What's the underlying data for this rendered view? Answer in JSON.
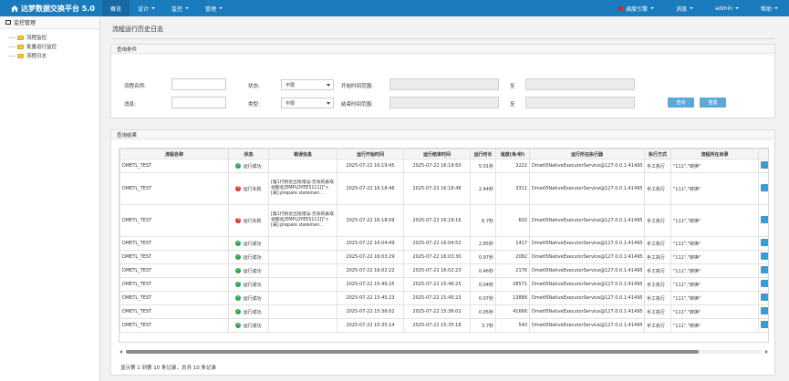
{
  "topbar": {
    "brand": "达梦数据交换平台 5.0",
    "nav": [
      {
        "label": "概览",
        "caret": false
      },
      {
        "label": "设计",
        "caret": true
      },
      {
        "label": "监控",
        "caret": true
      },
      {
        "label": "管理",
        "caret": true
      }
    ],
    "engine": "调度引擎",
    "messages": "消息",
    "user": "admin",
    "help": "帮助"
  },
  "sidebar": {
    "title": "监控管理",
    "items": [
      "流程监控",
      "批量运行监控",
      "流程日志"
    ]
  },
  "page": {
    "title": "流程运行历史日志"
  },
  "query": {
    "header": "查询条件",
    "name_label": "流程名称:",
    "status_label": "状态:",
    "status_value": "不限",
    "start_label": "开始时间范围:",
    "to1": "至",
    "msg_label": "消息:",
    "type_label": "类型:",
    "type_value": "不限",
    "end_label": "结束时间范围:",
    "to2": "至",
    "search_btn": "查询",
    "reset_btn": "重置"
  },
  "results": {
    "header": "查询结果",
    "columns": [
      "流程名称",
      "状态",
      "错误信息",
      "运行开始时间",
      "运行结束时间",
      "运行时长",
      "速度(条/秒)",
      "运行所在执行器",
      "执行方式",
      "流程所在目录",
      ""
    ],
    "rows": [
      {
        "name": "DMETL_TEST",
        "status": "运行成功",
        "ok": true,
        "error": "",
        "start": "2025-07-22 16:19:45",
        "end": "2025-07-22 16:19:50",
        "duration": "5.01秒",
        "speed": "3222",
        "executor": "DmetI5NativeExecutorService@127.0.0.1:41495",
        "mode": "手工执行",
        "dir": "\"111\",\"转换\""
      },
      {
        "name": "DMETL_TEST",
        "status": "运行失败",
        "ok": false,
        "error": "[第1行附近出现错误:无效的表或视图名[EMPLOYEES111]]\">[表]:prepare statemen...",
        "start": "2025-07-22 16:18:46",
        "end": "2025-07-22 16:18:48",
        "duration": "2.44秒",
        "speed": "3311",
        "executor": "DmetI5NativeExecutorService@127.0.0.1:41495",
        "mode": "手工执行",
        "dir": "\"111\",\"转换\""
      },
      {
        "name": "DMETL_TEST",
        "status": "运行失败",
        "ok": false,
        "error": "[第1行附近出现错误:无效的表或视图名[EMPLOYEES111]]\">[表]:prepare statemen...",
        "start": "2025-07-22 16:18:09",
        "end": "2025-07-22 16:18:16",
        "duration": "6.7秒",
        "speed": "602",
        "executor": "DmetI5NativeExecutorService@127.0.0.1:41495",
        "mode": "手工执行",
        "dir": "\"111\",\"转换\""
      },
      {
        "name": "DMETL_TEST",
        "status": "运行成功",
        "ok": true,
        "error": "",
        "start": "2025-07-22 16:04:49",
        "end": "2025-07-22 16:04:52",
        "duration": "2.85秒",
        "speed": "1417",
        "executor": "DmetI5NativeExecutorService@127.0.0.1:41495",
        "mode": "手工执行",
        "dir": "\"111\",\"转换\""
      },
      {
        "name": "DMETL_TEST",
        "status": "运行成功",
        "ok": true,
        "error": "",
        "start": "2025-07-22 16:03:29",
        "end": "2025-07-22 16:03:30",
        "duration": "0.97秒",
        "speed": "2082",
        "executor": "DmetI5NativeExecutorService@127.0.0.1:41495",
        "mode": "手工执行",
        "dir": "\"111\",\"转换\""
      },
      {
        "name": "DMETL_TEST",
        "status": "运行成功",
        "ok": true,
        "error": "",
        "start": "2025-07-22 16:02:22",
        "end": "2025-07-22 16:02:23",
        "duration": "0.46秒",
        "speed": "2176",
        "executor": "DmetI5NativeExecutorService@127.0.0.1:41495",
        "mode": "手工执行",
        "dir": "\"111\",\"转换\""
      },
      {
        "name": "DMETL_TEST",
        "status": "运行成功",
        "ok": true,
        "error": "",
        "start": "2025-07-22 15:46:25",
        "end": "2025-07-22 15:46:25",
        "duration": "0.04秒",
        "speed": "28571",
        "executor": "DmetI5NativeExecutorService@127.0.0.1:41495",
        "mode": "手工执行",
        "dir": "\"111\",\"转换\""
      },
      {
        "name": "DMETL_TEST",
        "status": "运行成功",
        "ok": true,
        "error": "",
        "start": "2025-07-22 15:45:23",
        "end": "2025-07-22 15:45:23",
        "duration": "0.07秒",
        "speed": "13888",
        "executor": "DmetI5NativeExecutorService@127.0.0.1:41495",
        "mode": "手工执行",
        "dir": "\"111\",\"转换\""
      },
      {
        "name": "DMETL_TEST",
        "status": "运行成功",
        "ok": true,
        "error": "",
        "start": "2025-07-22 15:36:02",
        "end": "2025-07-22 15:36:02",
        "duration": "0.05秒",
        "speed": "41666",
        "executor": "DmetI5NativeExecutorService@127.0.0.1:41495",
        "mode": "手工执行",
        "dir": "\"111\",\"转换\""
      },
      {
        "name": "DMETL_TEST",
        "status": "运行成功",
        "ok": true,
        "error": "",
        "start": "2025-07-22 15:35:14",
        "end": "2025-07-22 15:35:18",
        "duration": "3.7秒",
        "speed": "540",
        "executor": "DmetI5NativeExecutorService@127.0.0.1:41495",
        "mode": "手工执行",
        "dir": "\"111\",\"转换\""
      }
    ],
    "summary": "显示第 1 到第 10 条记录，总共 10 条记录"
  },
  "colors": {
    "topbar": "#1a7bbd",
    "button": "#5aaad9",
    "success": "#2ea44f",
    "failure": "#d33b2c"
  }
}
